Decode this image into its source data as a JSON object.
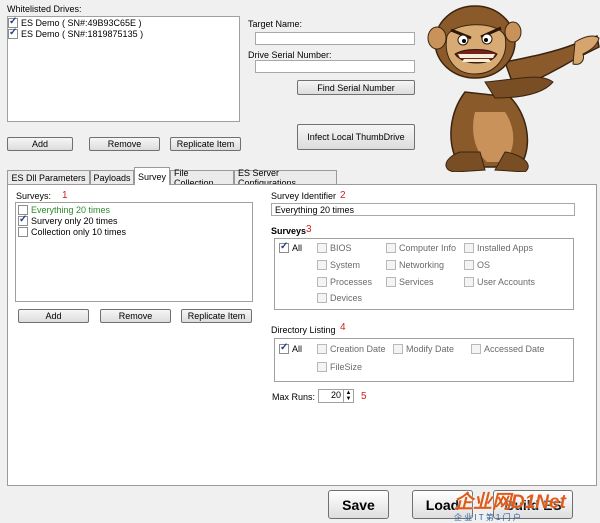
{
  "whitelist": {
    "label": "Whitelisted Drives:",
    "drives": [
      {
        "label": "ES Demo ( SN#:49B93C65E )",
        "checked": true
      },
      {
        "label": "ES Demo ( SN#:1819875135 )",
        "checked": true
      }
    ],
    "add_label": "Add",
    "remove_label": "Remove",
    "replicate_label": "Replicate Item"
  },
  "target": {
    "name_label": "Target Name:",
    "name_value": "",
    "serial_label": "Drive Serial Number:",
    "serial_value": "",
    "find_serial_label": "Find Serial Number",
    "infect_label": "Infect Local ThumbDrive"
  },
  "tabs": [
    {
      "label": "ES Dll Parameters",
      "active": false
    },
    {
      "label": "Payloads",
      "active": false
    },
    {
      "label": "Survey",
      "active": true
    },
    {
      "label": "File Collection",
      "active": false
    },
    {
      "label": "ES Server Configurations",
      "active": false
    }
  ],
  "surveys": {
    "label": "Surveys:",
    "marker": "1",
    "items": [
      {
        "label": "Everything 20 times",
        "checked": false,
        "color": "#2e8b2e"
      },
      {
        "label": "Survery only 20 times",
        "checked": true,
        "color": "#000000"
      },
      {
        "label": "Collection only 10 times",
        "checked": false,
        "color": "#000000"
      }
    ],
    "add_label": "Add",
    "remove_label": "Remove",
    "replicate_label": "Replicate Item"
  },
  "identifier": {
    "label": "Survey Identifier",
    "marker": "2",
    "value": "Everything 20 times"
  },
  "surveys_group": {
    "label": "Surveys",
    "marker": "3",
    "all_label": "All",
    "options": [
      "BIOS",
      "Computer Info",
      "Installed Apps",
      "System",
      "Networking",
      "OS",
      "Processes",
      "Services",
      "User Accounts",
      "Devices"
    ]
  },
  "directory": {
    "label": "Directory Listing",
    "marker": "4",
    "all_label": "All",
    "options": [
      "Creation Date",
      "Modify Date",
      "Accessed Date",
      "FileSize"
    ]
  },
  "max_runs": {
    "label": "Max Runs:",
    "value": "20",
    "marker": "5"
  },
  "footer": {
    "save_label": "Save",
    "load_label": "Load",
    "build_label": "Build ES"
  },
  "watermark": {
    "text": "企业网D1Net",
    "sub": "企 业 I T 第 1 门 户"
  }
}
